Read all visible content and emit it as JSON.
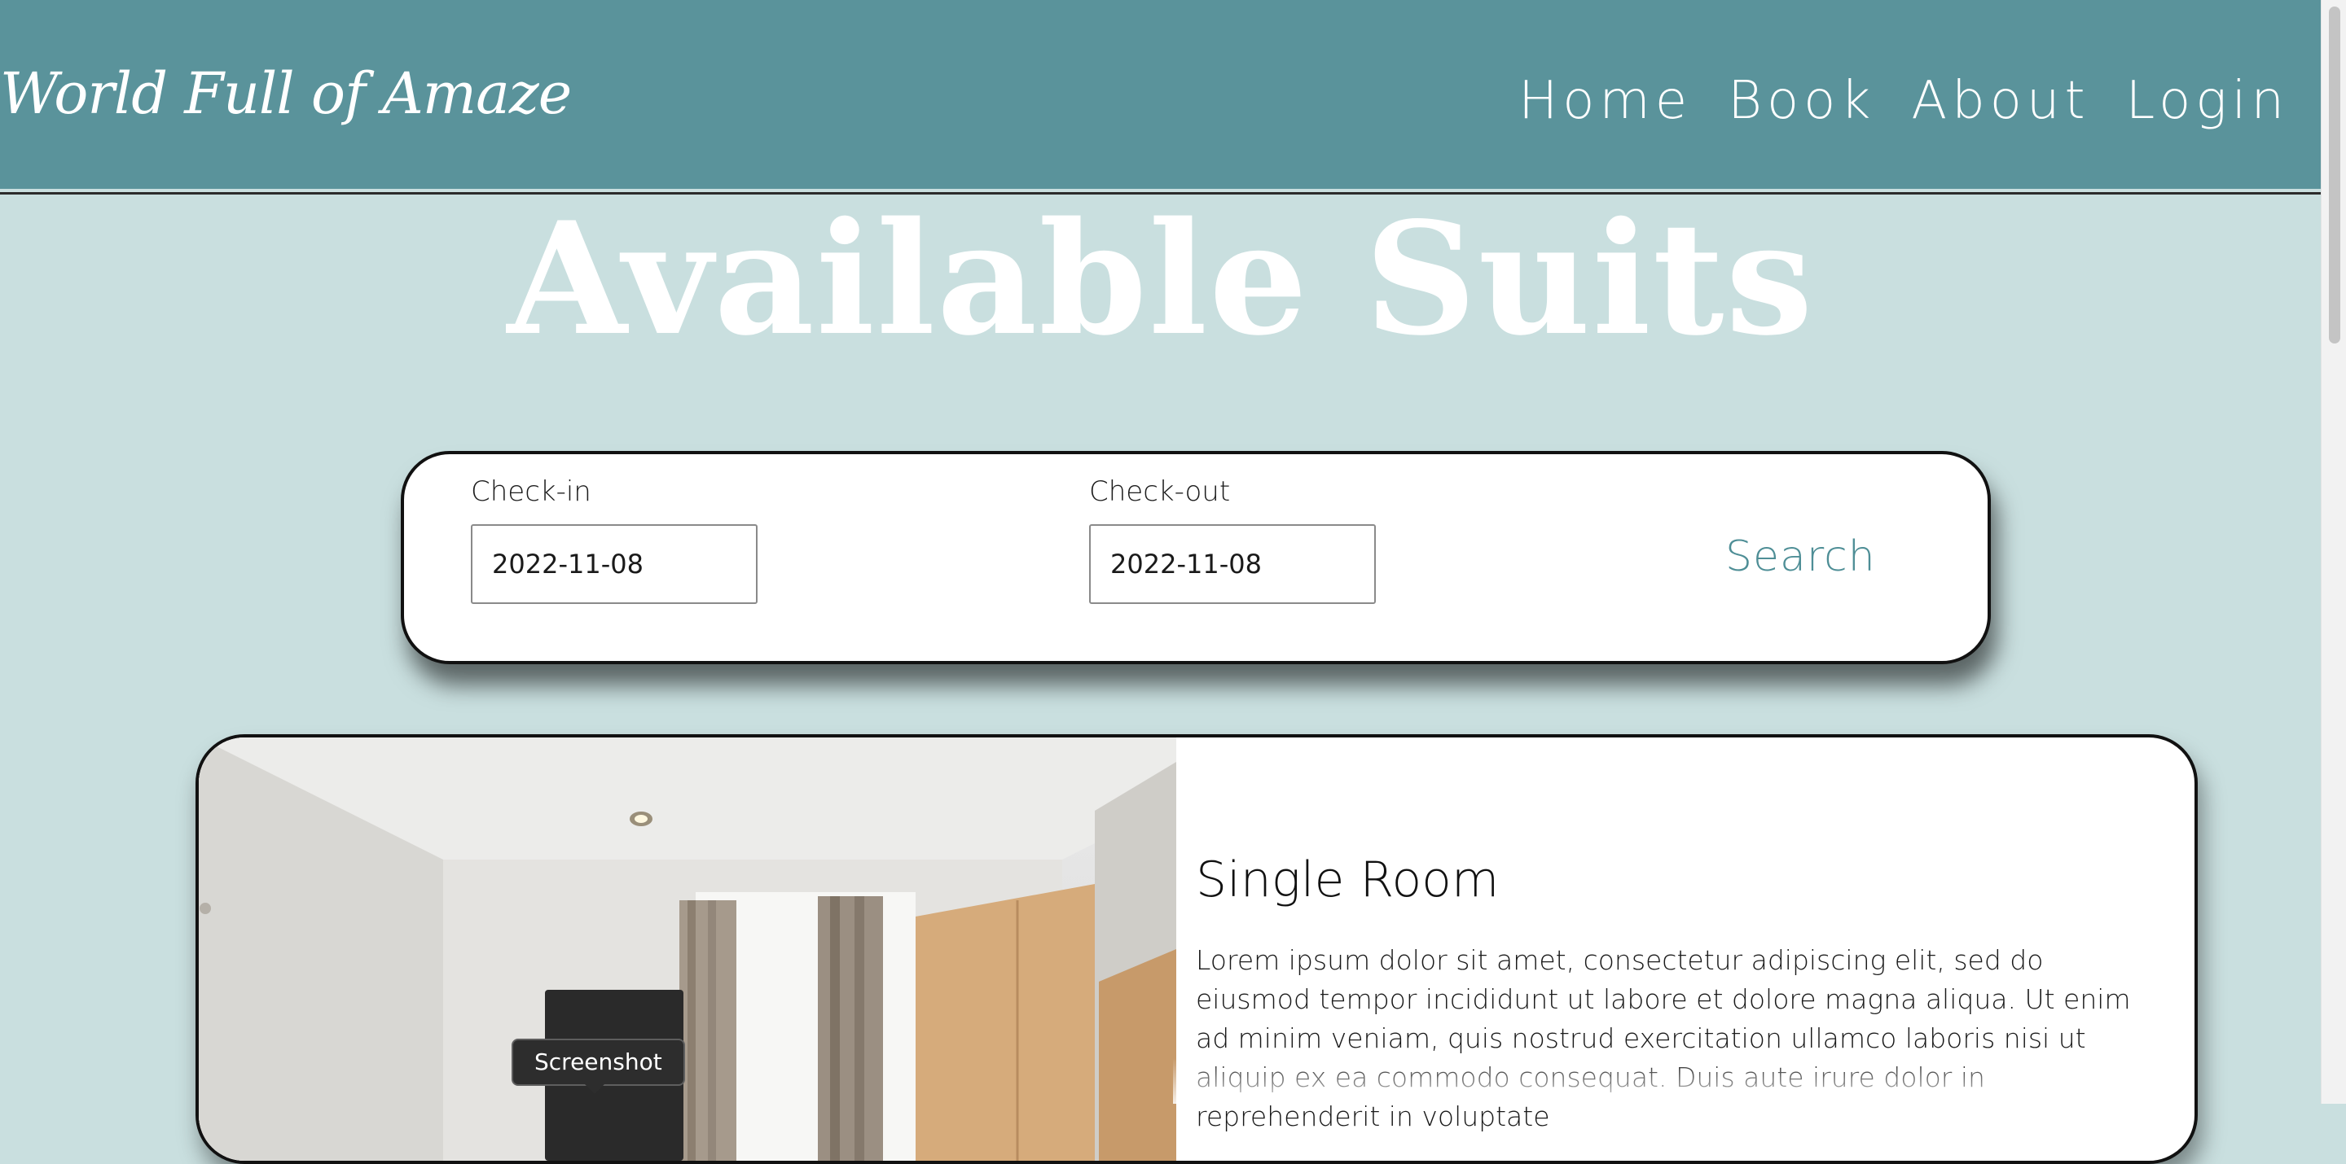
{
  "brand": {
    "name": "World Full of Amaze"
  },
  "nav": {
    "items": [
      {
        "label": "Home"
      },
      {
        "label": "Book"
      },
      {
        "label": "About"
      },
      {
        "label": "Login"
      }
    ]
  },
  "main": {
    "title": "Available Suits"
  },
  "search": {
    "checkin_label": "Check-in",
    "checkin_value": "2022-11-08",
    "checkout_label": "Check-out",
    "checkout_value": "2022-11-08",
    "search_label": "Search"
  },
  "rooms": [
    {
      "title": "Single Room",
      "description": "Lorem ipsum dolor sit amet, consectetur adipiscing elit, sed do eiusmod tempor incididunt ut labore et dolore magna aliqua. Ut enim ad minim veniam, quis nostrud exercitation ullamco laboris nisi ut aliquip ex ea commodo consequat. Duis aute irure dolor in reprehenderit in voluptate"
    }
  ],
  "tooltip": {
    "text": "Screenshot"
  },
  "colors": {
    "header_bg": "#5a939b",
    "page_bg": "#c9dfdf",
    "accent": "#4e8e96",
    "card_bg": "#ffffff"
  }
}
